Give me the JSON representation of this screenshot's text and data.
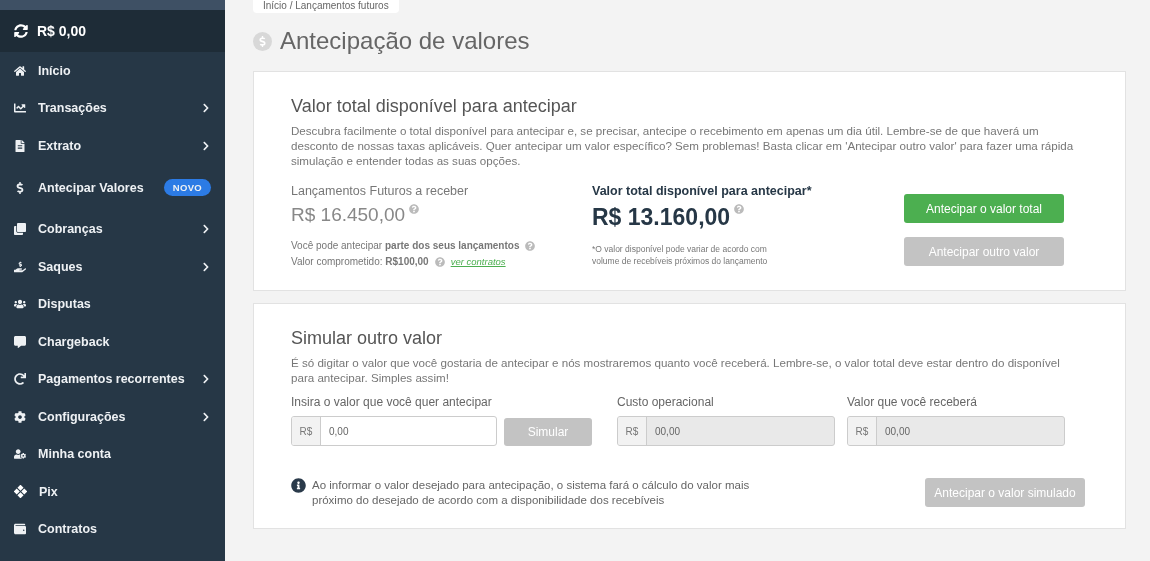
{
  "sidebar": {
    "balance": "R$ 0,00",
    "items": [
      {
        "label": "Início",
        "expandable": false
      },
      {
        "label": "Transações",
        "expandable": true
      },
      {
        "label": "Extrato",
        "expandable": true
      },
      {
        "label": "Antecipar Valores",
        "expandable": false,
        "badge": "NOVO"
      },
      {
        "label": "Cobranças",
        "expandable": true
      },
      {
        "label": "Saques",
        "expandable": true
      },
      {
        "label": "Disputas",
        "expandable": false
      },
      {
        "label": "Chargeback",
        "expandable": false
      },
      {
        "label": "Pagamentos recorrentes",
        "expandable": true
      },
      {
        "label": "Configurações",
        "expandable": true
      },
      {
        "label": "Minha conta",
        "expandable": false
      },
      {
        "label": "Pix",
        "expandable": false
      },
      {
        "label": "Contratos",
        "expandable": false
      }
    ]
  },
  "breadcrumb": "Início / Lançamentos futuros",
  "page_title": "Antecipação de valores",
  "summary": {
    "title": "Valor total disponível para antecipar",
    "description": "Descubra facilmente o total disponível para antecipar e, se precisar, antecipe o recebimento em apenas um dia útil. Lembre-se de que haverá um desconto de nossas taxas aplicáveis. Quer antecipar um valor específico? Sem problemas! Basta clicar em 'Antecipar outro valor' para fazer uma rápida simulação e entender todas as suas opções.",
    "future_label": "Lançamentos Futuros a receber",
    "future_amount": "R$ 16.450,00",
    "partial_note": "Você pode antecipar **parte dos seus lançamentos**",
    "committed": "Valor comprometido: **R$100,00**",
    "contracts_link": "ver contratos",
    "available_label": "Valor total disponível para antecipar*",
    "available_amount": "R$ 13.160,00",
    "disclaimer": "*O valor disponível pode variar de acordo com volume de recebíveis próximos do lançamento",
    "buttons": [
      {
        "label": "Antecipar o valor total",
        "disabled": false
      },
      {
        "label": "Antecipar outro valor",
        "disabled": true
      }
    ]
  },
  "simulate": {
    "title": "Simular outro valor",
    "description": "É só digitar o valor que você gostaria de antecipar e nós mostraremos quanto você receberá. Lembre-se, o valor total deve estar dentro do disponível para antecipar. Simples assim!",
    "fields": [
      {
        "label": "Insira o valor que você quer antecipar",
        "prefix": "R$",
        "value": "0,00",
        "disabled": false
      },
      {
        "label": "Custo operacional",
        "prefix": "R$",
        "value": "00,00",
        "disabled": true
      },
      {
        "label": "Valor que você receberá",
        "prefix": "R$",
        "value": "00,00",
        "disabled": true
      }
    ],
    "simulate_button": {
      "label": "Simular",
      "disabled": true
    },
    "info": "Ao informar o valor desejado para antecipação, o sistema fará o cálculo do valor mais próximo do desejado de acordo com a disponibilidade dos recebíveis",
    "submit_button": {
      "label": "Antecipar o valor simulado",
      "disabled": true
    }
  }
}
